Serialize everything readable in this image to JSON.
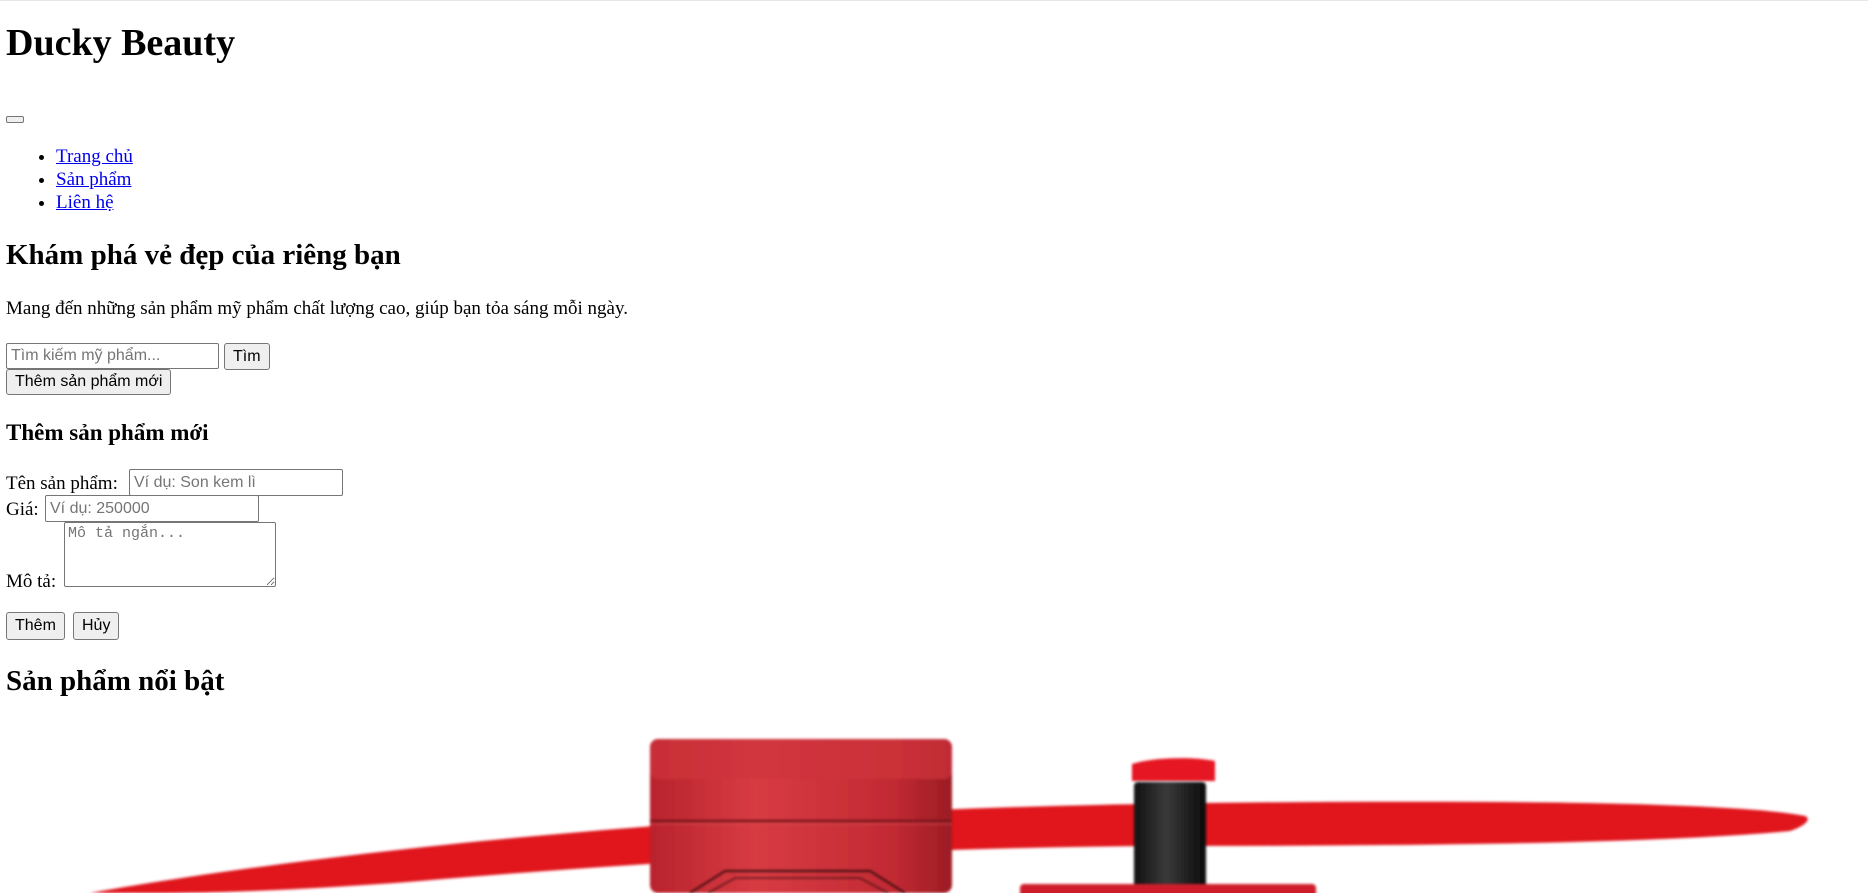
{
  "header": {
    "site_title": "Ducky Beauty",
    "menu_toggle_label": ""
  },
  "nav": {
    "items": [
      {
        "label": "Trang chủ"
      },
      {
        "label": "Sản phẩm"
      },
      {
        "label": "Liên hệ"
      }
    ]
  },
  "hero": {
    "title": "Khám phá vẻ đẹp của riêng bạn",
    "description": "Mang đến những sản phẩm mỹ phẩm chất lượng cao, giúp bạn tỏa sáng mỗi ngày."
  },
  "search": {
    "placeholder": "Tìm kiếm mỹ phẩm...",
    "value": "",
    "button_label": "Tìm"
  },
  "add_product_toggle_label": "Thêm sản phẩm mới",
  "add_form": {
    "title": "Thêm sản phẩm mới",
    "name_label": "Tên sản phẩm:",
    "name_placeholder": "Ví dụ: Son kem lì",
    "price_label": "Giá:",
    "price_placeholder": "Ví dụ: 250000",
    "description_label": "Mô tả:",
    "description_placeholder": "Mô tả ngắn...",
    "submit_label": "Thêm",
    "cancel_label": "Hủy"
  },
  "featured": {
    "title": "Sản phẩm nổi bật",
    "image_icon": "red-lipstick-product-image"
  },
  "colors": {
    "link": "#0000ee",
    "product_red": "#e0121f",
    "product_dark_red": "#c42a32"
  }
}
